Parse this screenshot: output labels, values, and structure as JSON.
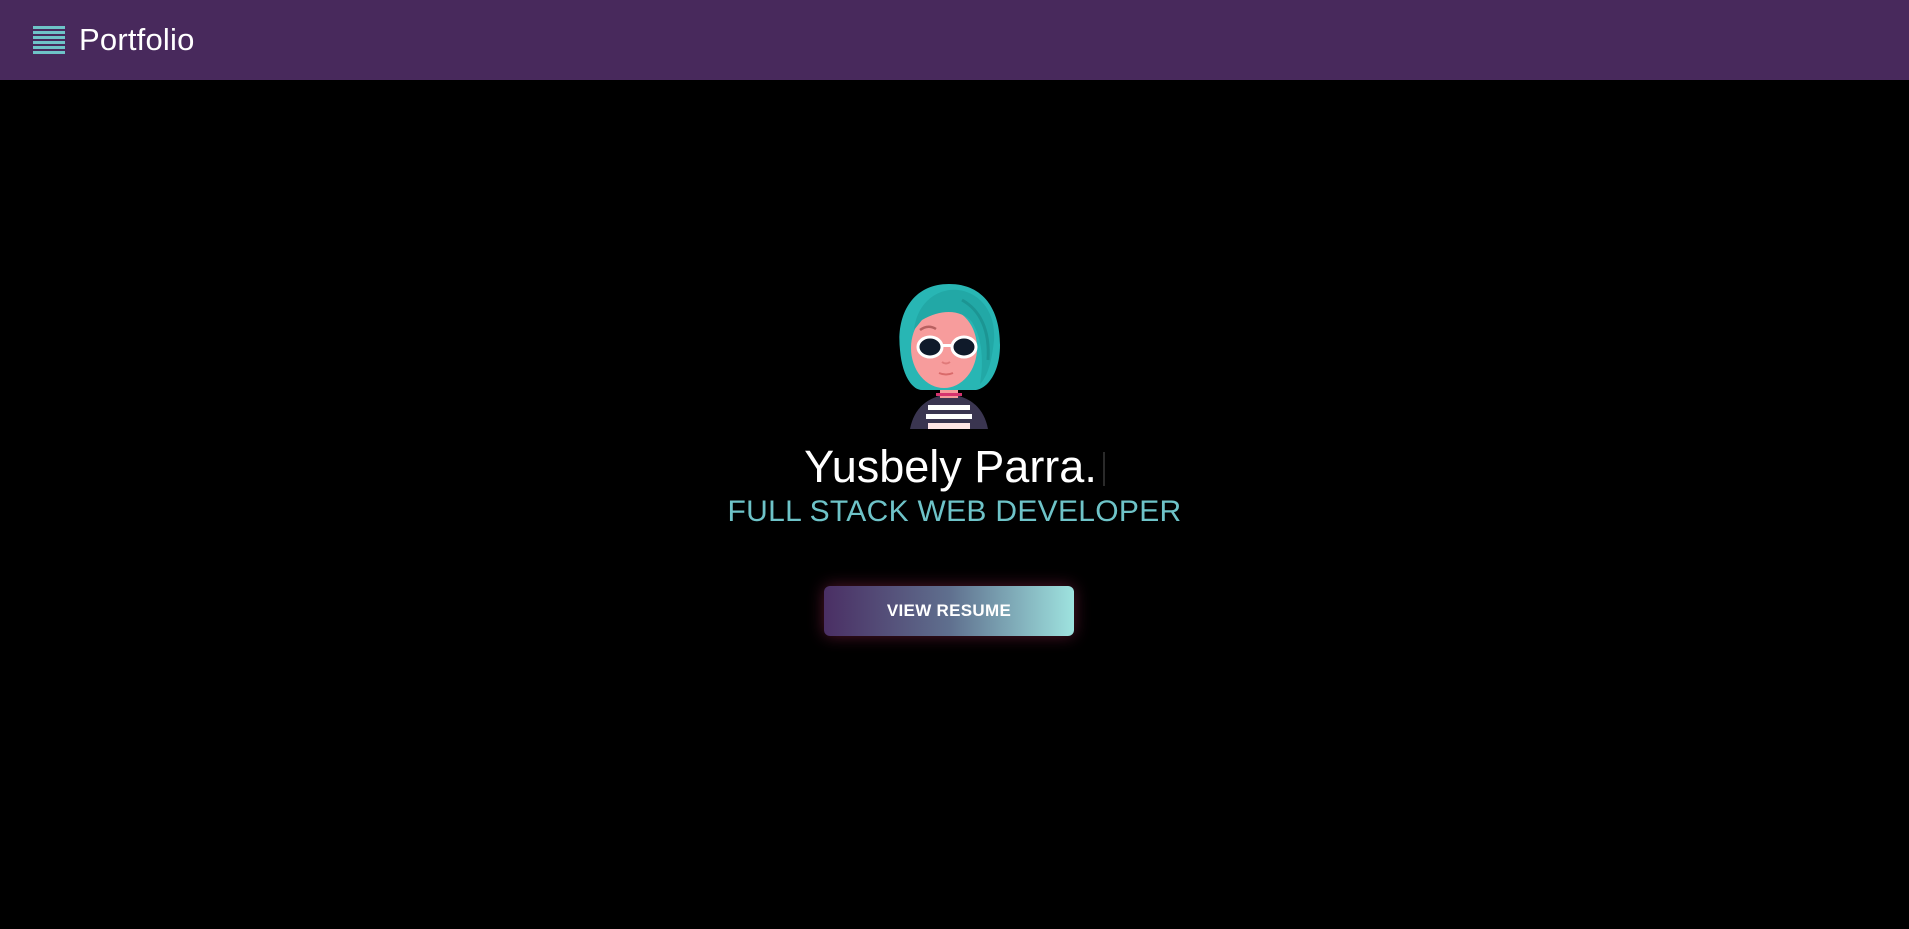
{
  "header": {
    "menu_icon": "hamburger-menu-icon",
    "brand": "Portfolio"
  },
  "hero": {
    "avatar_icon": "avatar-illustration",
    "name": "Yusbely Parra.",
    "role": "FULL STACK WEB DEVELOPER",
    "cta_label": "VIEW RESUME"
  },
  "colors": {
    "header_bg": "#48295c",
    "page_bg": "#000000",
    "accent": "#6ec3c8",
    "button_gradient_start": "#4a2f64",
    "button_gradient_end": "#9ee3df"
  }
}
